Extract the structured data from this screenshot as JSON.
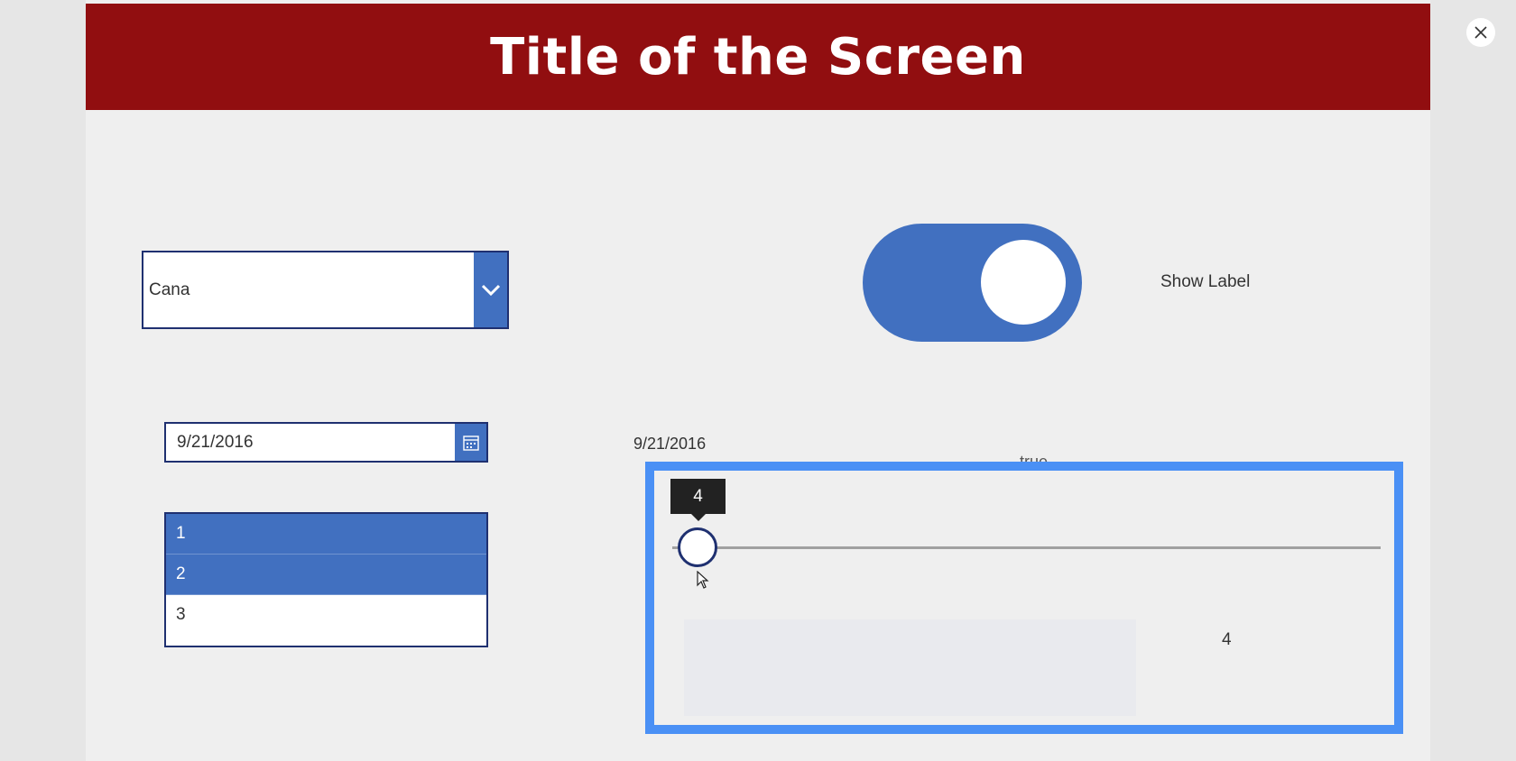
{
  "header": {
    "title": "Title of the Screen"
  },
  "close_button": {
    "icon": "close-icon"
  },
  "dropdown": {
    "selected_value": "Cana",
    "icon": "chevron-down-icon"
  },
  "toggle": {
    "state": "on",
    "label": "Show Label"
  },
  "date_picker": {
    "value": "9/21/2016",
    "icon": "calendar-icon"
  },
  "date_label": {
    "text": "9/21/2016"
  },
  "list_box": {
    "items": [
      {
        "label": "1",
        "selected": true
      },
      {
        "label": "2",
        "selected": true
      },
      {
        "label": "3",
        "selected": false
      }
    ]
  },
  "toggle_value_label": {
    "text": "true"
  },
  "slider": {
    "value": "4",
    "min": 0,
    "max": 100,
    "tooltip": "4"
  },
  "slider_value_label": {
    "text": "4"
  },
  "colors": {
    "header": "#910e10",
    "accent": "#4170c0",
    "border": "#1f3070",
    "selection": "#4a90f5"
  }
}
